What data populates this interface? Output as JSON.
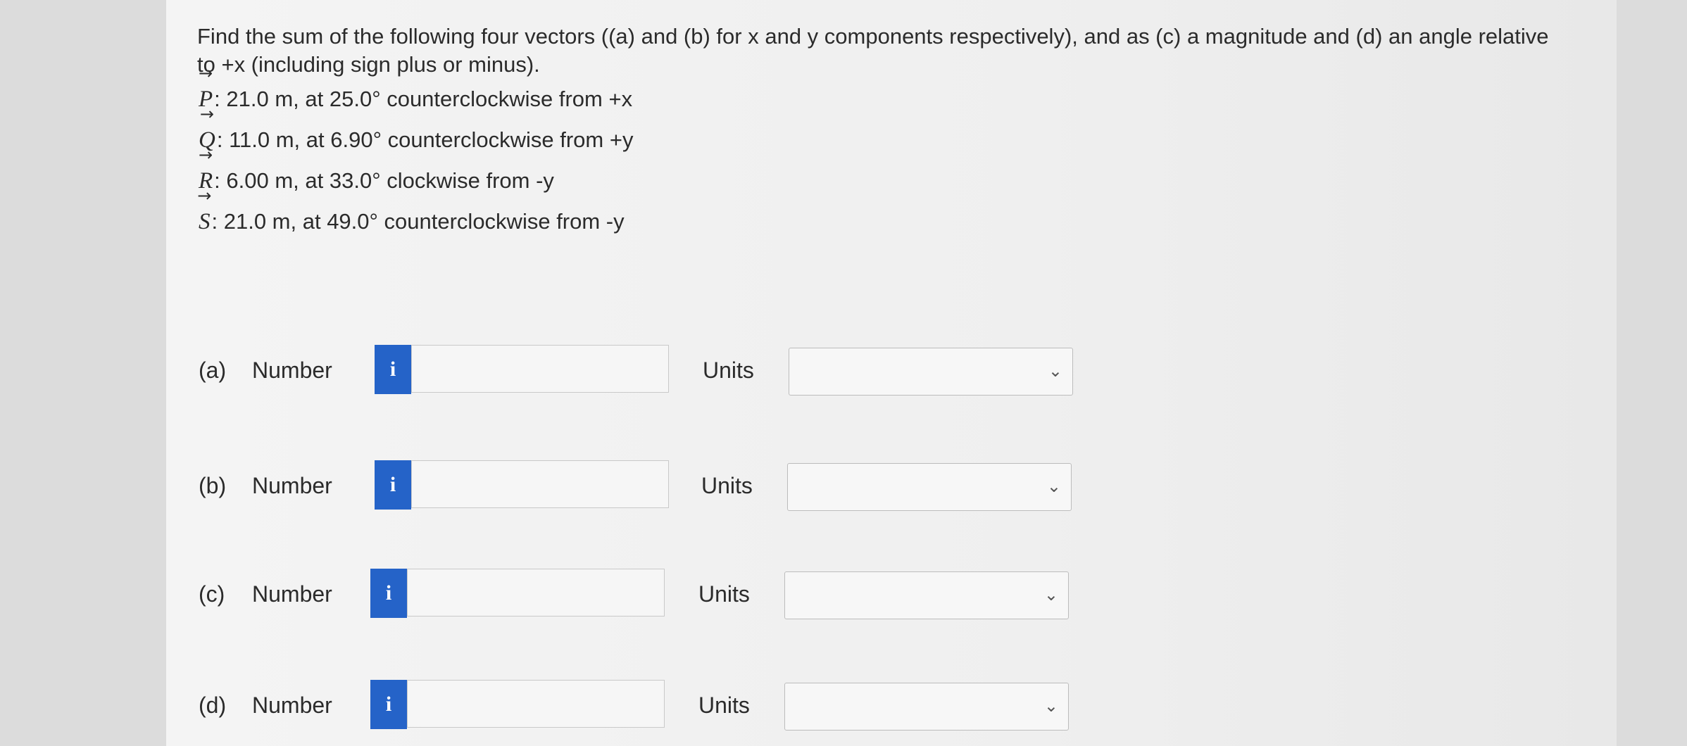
{
  "question": {
    "prompt": "Find the sum of the following four vectors ((a) and (b) for x and y components respectively), and as (c) a magnitude and (d) an angle relative to +x (including sign plus or minus).",
    "arrow": "→",
    "vectors": [
      {
        "symbol": "P",
        "text": ": 21.0 m, at 25.0° counterclockwise from +x"
      },
      {
        "symbol": "Q",
        "text": ": 11.0 m, at 6.90° counterclockwise from +y"
      },
      {
        "symbol": "R",
        "text": ": 6.00 m, at 33.0° clockwise from -y"
      },
      {
        "symbol": "S",
        "text": ": 21.0 m, at 49.0° counterclockwise from -y"
      }
    ]
  },
  "answers": [
    {
      "part": "(a)",
      "number_label": "Number",
      "info": "i",
      "value": "",
      "units_label": "Units",
      "units_value": ""
    },
    {
      "part": "(b)",
      "number_label": "Number",
      "info": "i",
      "value": "",
      "units_label": "Units",
      "units_value": ""
    },
    {
      "part": "(c)",
      "number_label": "Number",
      "info": "i",
      "value": "",
      "units_label": "Units",
      "units_value": ""
    },
    {
      "part": "(d)",
      "number_label": "Number",
      "info": "i",
      "value": "",
      "units_label": "Units",
      "units_value": ""
    }
  ],
  "icons": {
    "info": "info-icon",
    "dropdown": "chevron-down-icon",
    "chevron": "⌄"
  },
  "colors": {
    "info_button": "#2563c8",
    "page": "#f2f2f2",
    "background": "#dcdcdc"
  }
}
